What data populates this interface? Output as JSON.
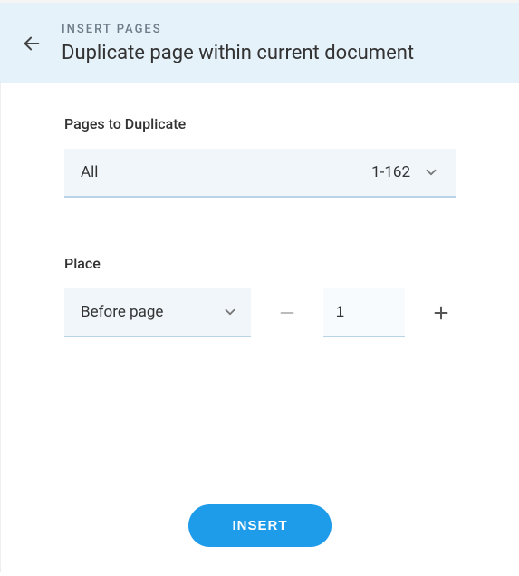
{
  "header": {
    "eyebrow": "INSERT PAGES",
    "title": "Duplicate page within current document"
  },
  "pages": {
    "label": "Pages to Duplicate",
    "selection_label": "All",
    "range": "1-162"
  },
  "place": {
    "label": "Place",
    "position_label": "Before page",
    "page_value": "1"
  },
  "actions": {
    "insert": "INSERT"
  }
}
